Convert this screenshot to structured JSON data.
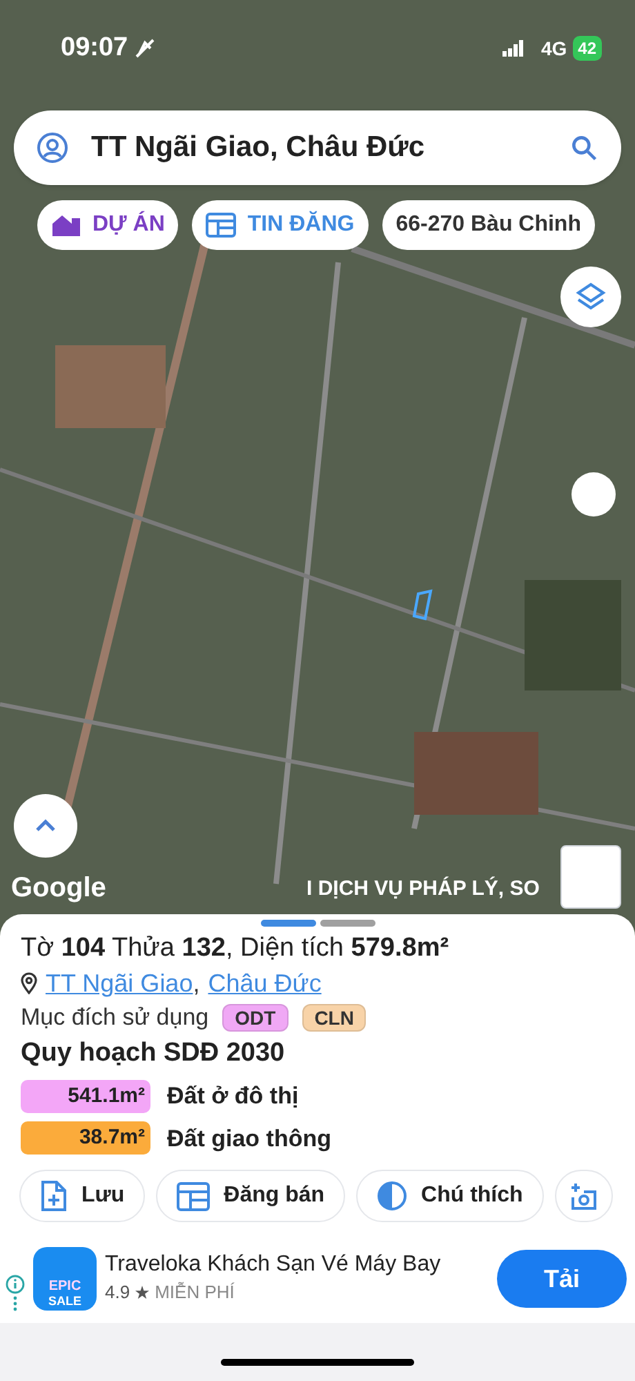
{
  "status_bar": {
    "time": "09:07",
    "network": "4G",
    "battery": "42"
  },
  "search": {
    "value": "TT Ngãi Giao, Châu Đức"
  },
  "chips": [
    {
      "kind": "project",
      "label": "DỰ ÁN"
    },
    {
      "kind": "listing",
      "label": "TIN ĐĂNG"
    },
    {
      "kind": "place",
      "label": "66-270 Bàu Chinh"
    }
  ],
  "map": {
    "attribution": "Google",
    "banner": "I DỊCH VỤ PHÁP LÝ, SO"
  },
  "sheet": {
    "pages": [
      {
        "selected": true
      },
      {
        "selected": false
      }
    ],
    "title": "Tờ **104** Thửa **132**, Diện tích **579.8m²**",
    "location_separator": ",",
    "location": [
      {
        "label": "TT Ngãi Giao"
      },
      {
        "label": "Châu Đức"
      }
    ],
    "usage_label": "Mục đích sử dụng",
    "usage_tags": [
      {
        "label": "ODT",
        "color": "#f0a8f5"
      },
      {
        "label": "CLN",
        "color": "#f8d3a8"
      }
    ],
    "plan_title": "Quy hoạch SDĐ 2030",
    "plan_rows": [
      {
        "area": "541.1m²",
        "label": "Đất ở đô thị",
        "color": "#f3a6f7"
      },
      {
        "area": "38.7m²",
        "label": "Đất giao thông",
        "color": "#fbab3b"
      }
    ],
    "actions": [
      {
        "kind": "save",
        "label": "Lưu"
      },
      {
        "kind": "sell",
        "label": "Đăng bán"
      },
      {
        "kind": "legend",
        "label": "Chú thích"
      },
      {
        "kind": "add-photo"
      }
    ]
  },
  "ad": {
    "icon_top": "EPIC",
    "icon_bottom": "SALE",
    "title": "Traveloka Khách Sạn Vé Máy Bay",
    "rating": "4.9",
    "price": "MIỄN PHÍ",
    "button": "Tải"
  }
}
